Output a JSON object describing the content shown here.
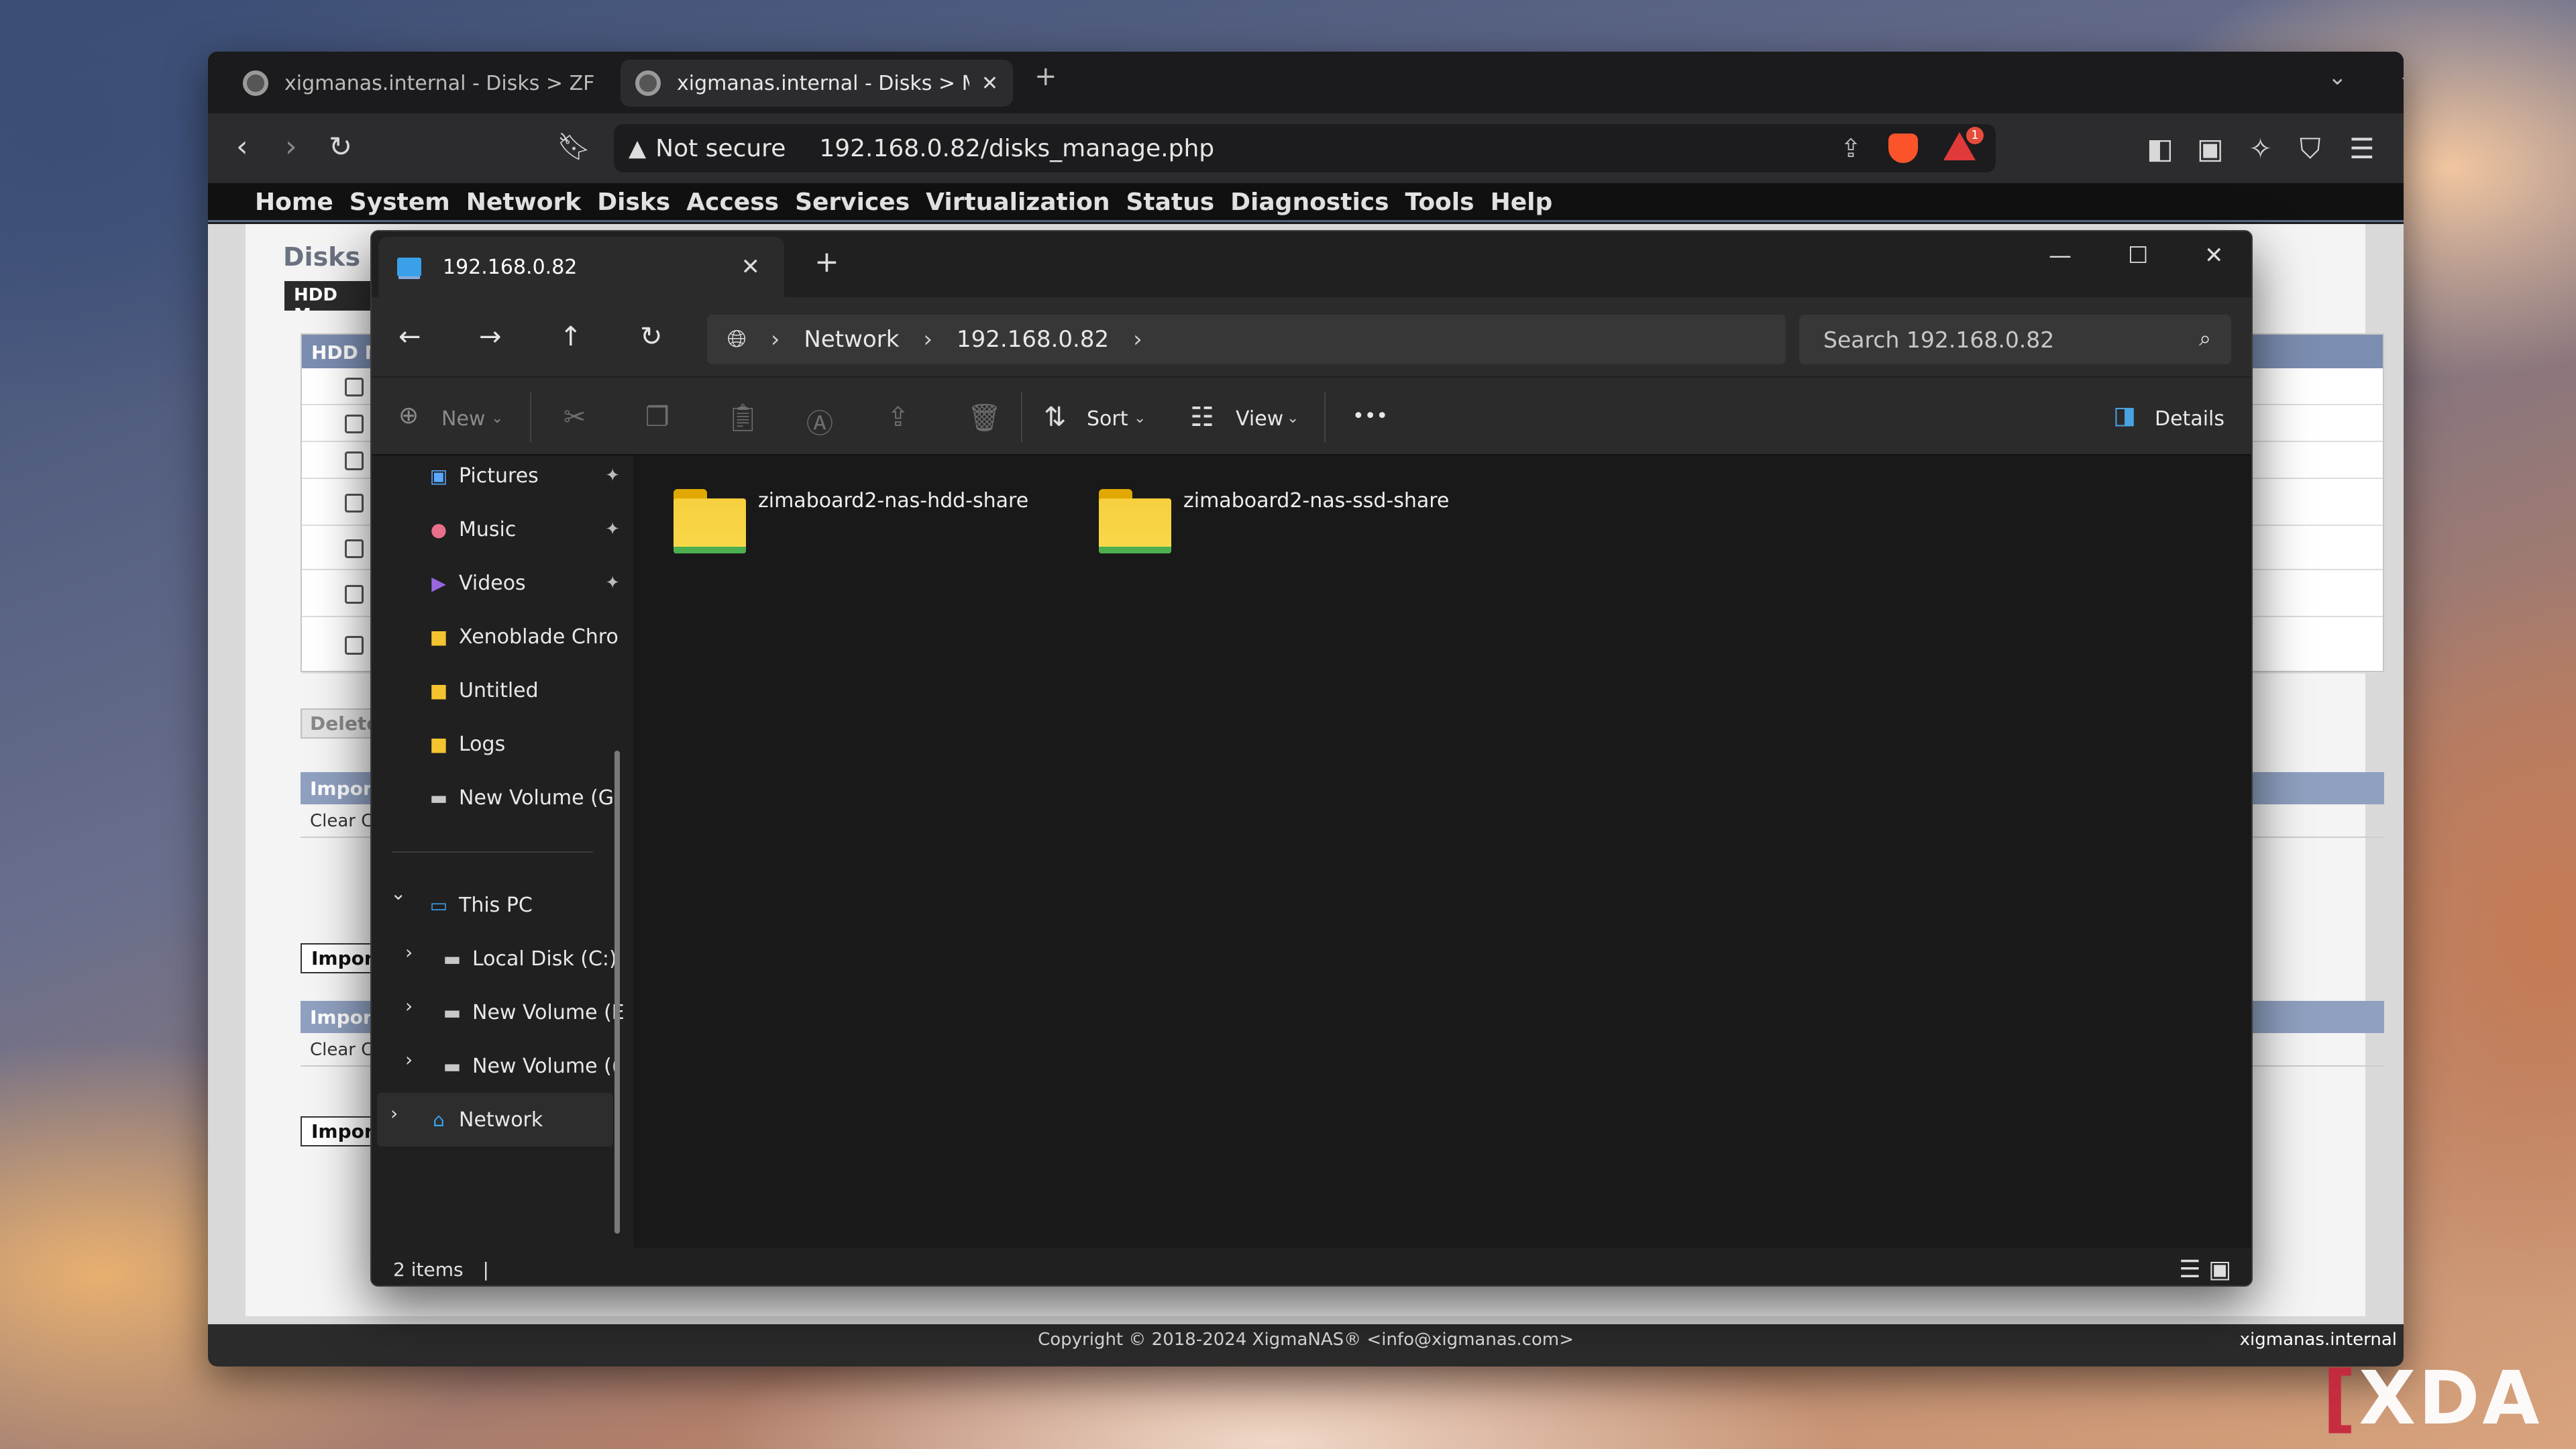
{
  "browser": {
    "tabs": [
      {
        "title": "xigmanas.internal - Disks > ZFS > Po"
      },
      {
        "title": "xigmanas.internal - Disks > Man",
        "close": "✕"
      }
    ],
    "new_tab": "+",
    "address": {
      "security": "Not secure",
      "url": "192.168.0.82/disks_manage.php"
    },
    "alert_count": "1"
  },
  "xigmanas": {
    "menu": [
      "Home",
      "System",
      "Network",
      "Disks",
      "Access",
      "Services",
      "Virtualization",
      "Status",
      "Diagnostics",
      "Tools",
      "Help"
    ],
    "breadcrumb": "Disks > Ma",
    "tab": "HDD Management",
    "hdd_header": "HDD Mana",
    "delete_button": "Delete Sele",
    "import_disks": {
      "header": "Import Dis",
      "row": "Clear Config",
      "button": "Import"
    },
    "import_soft": {
      "header": "Import So",
      "row": "Clear Config",
      "button": "Import"
    },
    "footer": "Copyright © 2018-2024 XigmaNAS® <info@xigmanas.com>",
    "hostname": "xigmanas.internal"
  },
  "explorer": {
    "tab_title": "192.168.0.82",
    "tab_close": "✕",
    "new_tab": "+",
    "breadcrumb": [
      "Network",
      "192.168.0.82"
    ],
    "search_placeholder": "Search 192.168.0.82",
    "commands": {
      "new": "New",
      "sort": "Sort",
      "view": "View",
      "more": "•••",
      "details": "Details"
    },
    "sidebar": {
      "quick": [
        {
          "label": "Pictures",
          "icon": "pictures-icon",
          "pinned": true
        },
        {
          "label": "Music",
          "icon": "music-icon",
          "pinned": true
        },
        {
          "label": "Videos",
          "icon": "videos-icon",
          "pinned": true
        },
        {
          "label": "Xenoblade Chro",
          "icon": "folder-icon"
        },
        {
          "label": "Untitled",
          "icon": "folder-icon"
        },
        {
          "label": "Logs",
          "icon": "folder-icon"
        },
        {
          "label": "New Volume (G:",
          "icon": "drive-icon"
        }
      ],
      "this_pc": "This PC",
      "drives": [
        "Local Disk (C:)",
        "New Volume (E",
        "New Volume (("
      ],
      "network": "Network"
    },
    "folders": [
      "zimaboard2-nas-hdd-share",
      "zimaboard2-nas-ssd-share"
    ],
    "status": "2 items"
  },
  "watermark": "XDA"
}
